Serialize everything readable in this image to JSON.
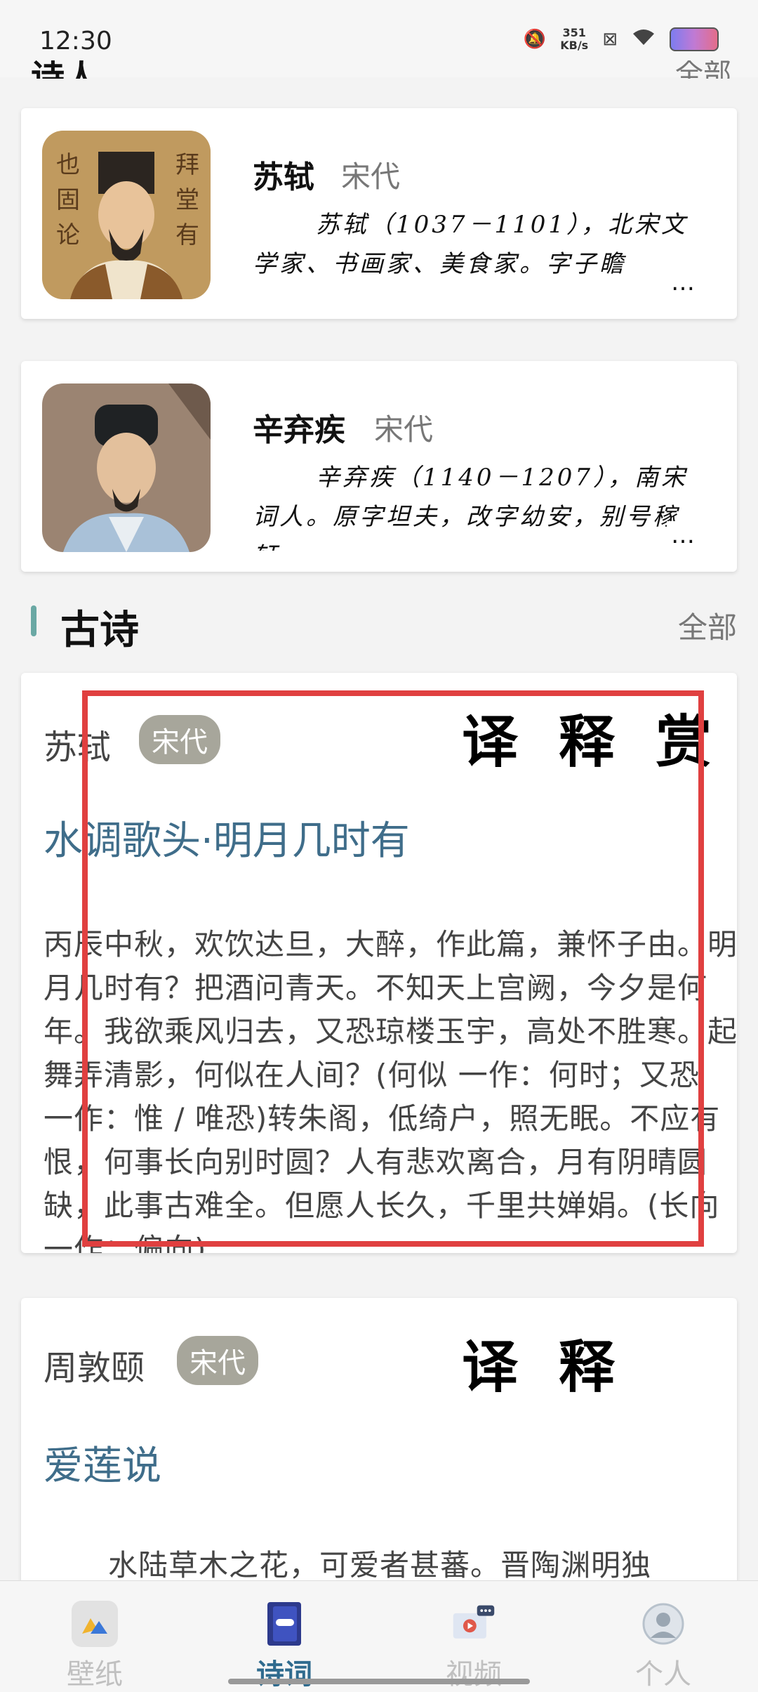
{
  "status": {
    "time": "12:30",
    "speed_value": "351",
    "speed_unit": "KB/s"
  },
  "top_section": {
    "title_partial": "诗人",
    "all_partial": "全部"
  },
  "poets": [
    {
      "name": "苏轼",
      "dynasty": "宋代",
      "bio": "苏轼（1037－1101），北宋文学家、书画家、美食家。字子瞻",
      "more": "…"
    },
    {
      "name": "辛弃疾",
      "dynasty": "宋代",
      "bio": "辛弃疾（1140－1207），南宋词人。原字坦夫，改字幼安，别号稼轩",
      "more": "…"
    }
  ],
  "section": {
    "title": "古诗",
    "all_label": "全部"
  },
  "poems": [
    {
      "author": "苏轼",
      "dynasty": "宋代",
      "title": "水调歌头·明月几时有",
      "body": "丙辰中秋，欢饮达旦，大醉，作此篇，兼怀子由。明月几时有？把酒问青天。不知天上宫阙，今夕是何年。我欲乘风归去，又恐琼楼玉宇，高处不胜寒。起舞弄清影，何似在人间？(何似 一作：何时；又恐 一作：惟 / 唯恐)转朱阁，低绮户，照无眠。不应有恨，何事长向别时圆？人有悲欢离合，月有阴晴圆缺，此事古难全。但愿人长久，千里共婵娟。(长向 一作：偏向)",
      "tags": [
        "译",
        "释",
        "赏"
      ]
    },
    {
      "author": "周敦颐",
      "dynasty": "宋代",
      "title": "爱莲说",
      "body": "水陆草木之花，可爱者甚蕃。晋陶渊明独",
      "tags": [
        "译",
        "释"
      ]
    }
  ],
  "nav": [
    {
      "label": "壁纸",
      "icon": "wallpaper-icon",
      "active": false
    },
    {
      "label": "诗词",
      "icon": "book-icon",
      "active": true
    },
    {
      "label": "视频",
      "icon": "video-icon",
      "active": false
    },
    {
      "label": "个人",
      "icon": "person-icon",
      "active": false
    }
  ],
  "colors": {
    "accent": "#2f6b8e",
    "title": "#3f6d8a",
    "pill": "#a7a69b",
    "highlight": "#e04040"
  }
}
